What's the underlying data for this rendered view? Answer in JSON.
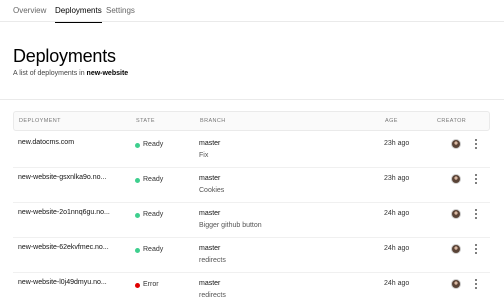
{
  "tabs": [
    {
      "label": "Overview"
    },
    {
      "label": "Deployments"
    },
    {
      "label": "Settings"
    }
  ],
  "header": {
    "title": "Deployments",
    "subtitle_prefix": "A list of deployments in ",
    "project": "new-website"
  },
  "table": {
    "columns": {
      "deployment": "DEPLOYMENT",
      "state": "STATE",
      "branch": "BRANCH",
      "age": "AGE",
      "creator": "CREATOR"
    },
    "rows": [
      {
        "deployment": "new.datocms.com",
        "state": "Ready",
        "state_color": "#3ecf8e",
        "branch": "master",
        "commit": "Fix",
        "age": "23h ago"
      },
      {
        "deployment": "new-website-gsxnlka9o.no...",
        "state": "Ready",
        "state_color": "#3ecf8e",
        "branch": "master",
        "commit": "Cookies",
        "age": "23h ago"
      },
      {
        "deployment": "new-website-2o1nnq6gu.no...",
        "state": "Ready",
        "state_color": "#3ecf8e",
        "branch": "master",
        "commit": "Bigger github button",
        "age": "24h ago"
      },
      {
        "deployment": "new-website-62ekvfmec.no...",
        "state": "Ready",
        "state_color": "#3ecf8e",
        "branch": "master",
        "commit": "redirects",
        "age": "24h ago"
      },
      {
        "deployment": "new-website-l0j49dmyu.no...",
        "state": "Error",
        "state_color": "#e00000",
        "branch": "master",
        "commit": "redirects",
        "age": "24h ago"
      }
    ]
  },
  "icons": {
    "avatar": "user-avatar",
    "more": "more-vertical-icon"
  }
}
